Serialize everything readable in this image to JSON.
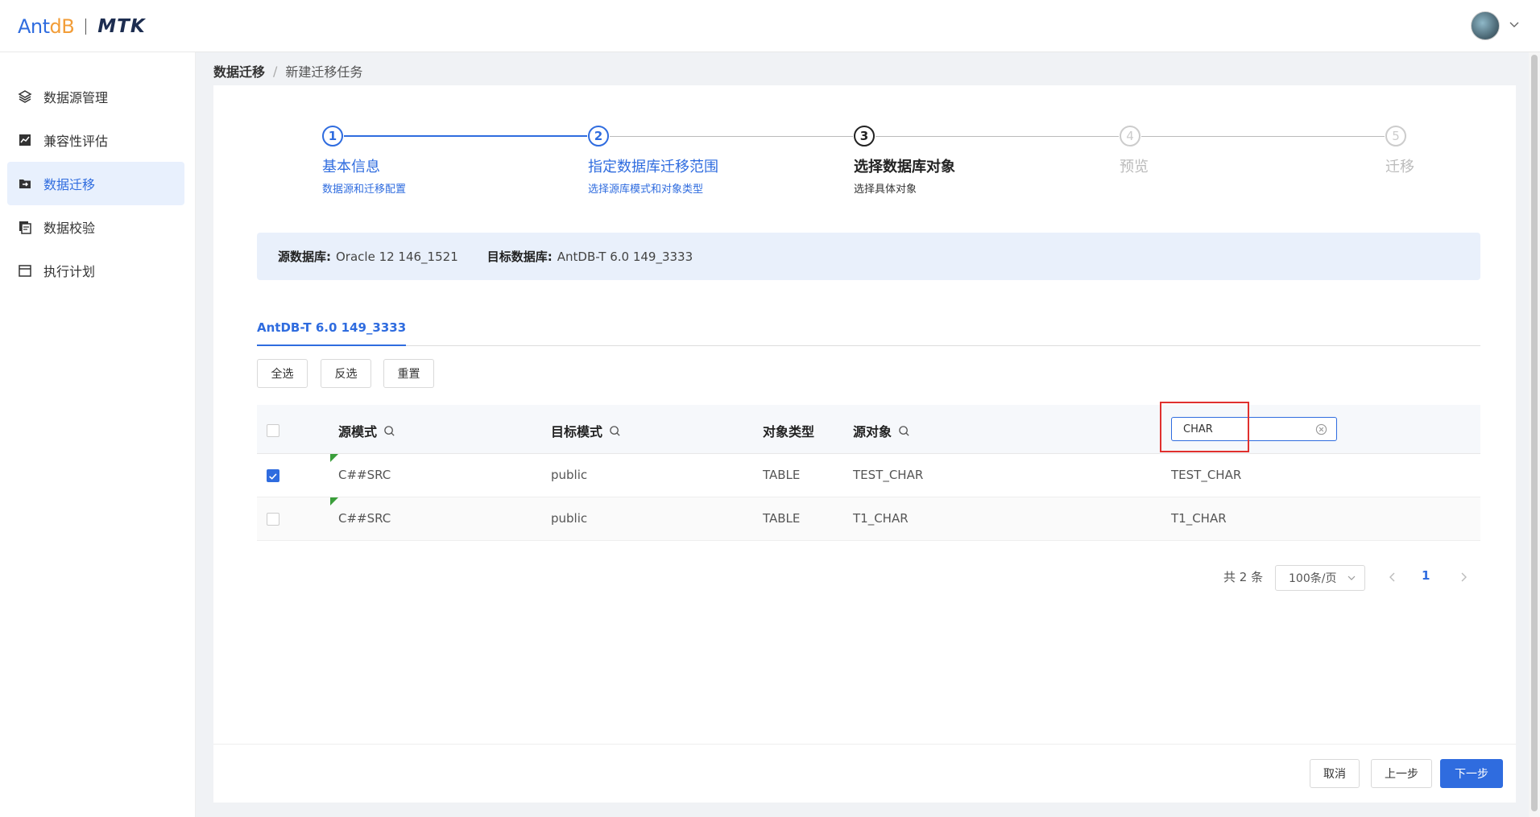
{
  "header": {
    "logo_brand": "AntDB",
    "logo_product": "MTK"
  },
  "sidebar": {
    "items": [
      {
        "label": "数据源管理",
        "icon": "layers-icon"
      },
      {
        "label": "兼容性评估",
        "icon": "chart-icon"
      },
      {
        "label": "数据迁移",
        "icon": "folder-arrow-icon",
        "active": true
      },
      {
        "label": "数据校验",
        "icon": "copy-icon"
      },
      {
        "label": "执行计划",
        "icon": "calendar-icon"
      }
    ]
  },
  "breadcrumb": {
    "parent": "数据迁移",
    "current": "新建迁移任务"
  },
  "steps": [
    {
      "num": "1",
      "title": "基本信息",
      "desc": "数据源和迁移配置",
      "status": "done"
    },
    {
      "num": "2",
      "title": "指定数据库迁移范围",
      "desc": "选择源库模式和对象类型",
      "status": "done"
    },
    {
      "num": "3",
      "title": "选择数据库对象",
      "desc": "选择具体对象",
      "status": "current"
    },
    {
      "num": "4",
      "title": "预览",
      "desc": "",
      "status": "wait"
    },
    {
      "num": "5",
      "title": "迁移",
      "desc": "",
      "status": "wait"
    }
  ],
  "info": {
    "source_label": "源数据库:",
    "source_value": "Oracle 12 146_1521",
    "target_label": "目标数据库:",
    "target_value": "AntDB-T 6.0 149_3333"
  },
  "tab": {
    "label": "AntDB-T 6.0 149_3333"
  },
  "actions": {
    "select_all": "全选",
    "invert": "反选",
    "reset": "重置"
  },
  "table": {
    "columns": [
      "源模式",
      "目标模式",
      "对象类型",
      "源对象"
    ],
    "filter_value": "CHAR",
    "rows": [
      {
        "checked": true,
        "src_schema": "C##SRC",
        "tgt_schema": "public",
        "type": "TABLE",
        "src_obj": "TEST_CHAR",
        "tgt_obj": "TEST_CHAR"
      },
      {
        "checked": false,
        "src_schema": "C##SRC",
        "tgt_schema": "public",
        "type": "TABLE",
        "src_obj": "T1_CHAR",
        "tgt_obj": "T1_CHAR"
      }
    ]
  },
  "pagination": {
    "total": "共 2 条",
    "page_size": "100条/页",
    "current_page": "1"
  },
  "footer": {
    "cancel": "取消",
    "prev": "上一步",
    "next": "下一步"
  },
  "colors": {
    "primary": "#2f6cdf",
    "highlight_box": "#e0302e"
  }
}
